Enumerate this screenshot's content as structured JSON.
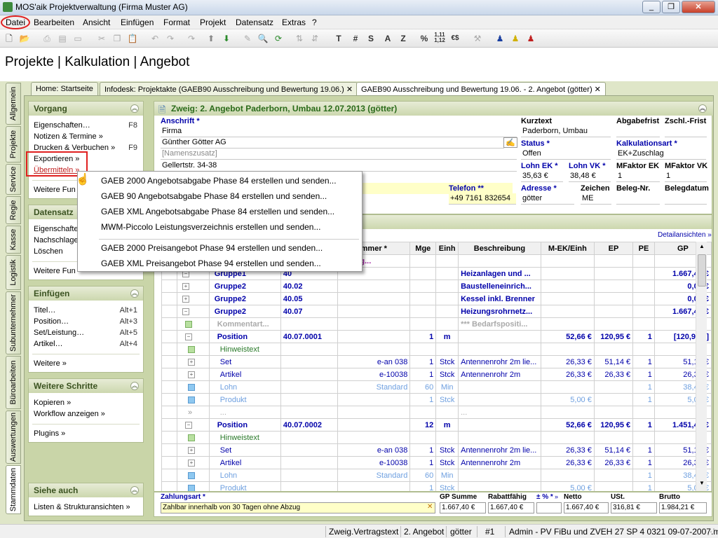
{
  "window": {
    "title": "MOS'aik Projektverwaltung (Firma Muster AG)",
    "controls": [
      "_",
      "❐",
      "✕"
    ]
  },
  "menu": [
    "Datei",
    "Bearbeiten",
    "Ansicht",
    "Einfügen",
    "Format",
    "Projekt",
    "Datensatz",
    "Extras",
    "?"
  ],
  "toolbar_text": {
    "t": "T",
    "hash": "#",
    "s": "S",
    "a": "A",
    "z": "Z",
    "pct": "%",
    "frac": "1,11\n1,12",
    "euro": "€$"
  },
  "page_title": "Projekte | Kalkulation | Angebot",
  "vtabs": [
    "Allgemein",
    "Projekte",
    "Service",
    "Regie",
    "Kasse",
    "Logistik",
    "Subunternehmer",
    "Büroarbeiten",
    "Auswertungen",
    "Stammdaten"
  ],
  "doctabs": [
    "Home: Startseite",
    "Infodesk: Projektakte (GAEB90 Ausschreibung und Bewertung 19.06.) ✕",
    "GAEB90 Ausschreibung und Bewertung 19.06. - 2. Angebot (götter) ✕"
  ],
  "panels": {
    "vorgang": {
      "title": "Vorgang",
      "items": [
        {
          "label": "Eigenschaften…",
          "key": "F8"
        },
        {
          "label": "Notizen & Termine »",
          "key": ""
        },
        {
          "label": "Drucken & Verbuchen »",
          "key": "F9"
        },
        {
          "label": "Exportieren »",
          "key": ""
        },
        {
          "label": "Übermitteln »",
          "key": ""
        },
        {
          "label": "Weitere Fun",
          "key": ""
        }
      ]
    },
    "datensatz": {
      "title": "Datensatz",
      "items": [
        "Eigenschafte",
        "Nachschlage",
        "Löschen",
        "Weitere Fun"
      ]
    },
    "einfuegen": {
      "title": "Einfügen",
      "items": [
        {
          "label": "Titel…",
          "key": "Alt+1"
        },
        {
          "label": "Position…",
          "key": "Alt+3"
        },
        {
          "label": "Set/Leistung…",
          "key": "Alt+5"
        },
        {
          "label": "Artikel…",
          "key": "Alt+4"
        },
        {
          "label": "Weitere »",
          "key": ""
        }
      ]
    },
    "weitere": {
      "title": "Weitere Schritte",
      "items": [
        "Kopieren »",
        "Workflow anzeigen »",
        "Plugins »"
      ]
    },
    "siehe": {
      "title": "Siehe auch",
      "items": [
        "Listen & Strukturansichten »"
      ]
    }
  },
  "popup": [
    "GAEB 2000 Angebotsabgabe Phase 84 erstellen und senden...",
    "GAEB 90 Angebotsabgabe Phase 84 erstellen und senden...",
    "GAEB XML Angebotsabgabe Phase 84 erstellen und senden...",
    "MWM-Piccolo Leistungsverzeichnis erstellen und senden...",
    "GAEB 2000 Preisangebot Phase 94 erstellen und senden...",
    "GAEB XML Preisangebot Phase 94 erstellen und senden..."
  ],
  "form": {
    "header": "Zweig: 2. Angebot Paderborn, Umbau 12.07.2013 (götter)",
    "anschrift_label": "Anschrift *",
    "anschrift": [
      "Firma",
      "Günther Götter AG",
      "[Namenszusatz]",
      "Gellertstr. 34-38"
    ],
    "kurztext_label": "Kurztext",
    "kurztext": "Paderborn, Umbau",
    "abgabefrist_label": "Abgabefrist",
    "zschl_label": "Zschl.-Frist",
    "status_label": "Status *",
    "status": "Offen",
    "kalkart_label": "Kalkulationsart *",
    "kalkart": "EK+Zuschlag",
    "lohnek_label": "Lohn EK *",
    "lohnek": "35,63 €",
    "lohnvk_label": "Lohn VK *",
    "lohnvk": "38,48 €",
    "mfek_label": "MFaktor EK",
    "mfek": "1",
    "mfvk_label": "MFaktor VK",
    "mfvk": "1",
    "telefon_label": "Telefon **",
    "telefon": "+49 7161 832654",
    "adresse_label": "Adresse *",
    "adresse": "götter",
    "zeichen_label": "Zeichen",
    "zeichen": "ME",
    "belegnr_label": "Beleg-Nr.",
    "belegdatum_label": "Belegdatum"
  },
  "grid": {
    "link": "Detailansichten »",
    "headers": [
      "",
      "",
      "",
      "mmer *",
      "Mge",
      "Einh",
      "Beschreibung",
      "M-EK/Einh",
      "EP",
      "PE",
      "GP"
    ],
    "rows": [
      {
        "tree": "",
        "type": "",
        "nr": "",
        "code": "B.Verg...",
        "mge": "",
        "einh": "",
        "besch": "",
        "mek": "",
        "ep": "",
        "pe": "",
        "gp": "",
        "style": "purple"
      },
      {
        "tree": "−",
        "type": "Gruppe1",
        "nr": "40",
        "code": "",
        "mge": "",
        "einh": "",
        "besch": "Heizanlagen und ...",
        "mek": "",
        "ep": "",
        "pe": "",
        "gp": "1.667,40 €",
        "style": "grp"
      },
      {
        "tree": "+",
        "type": "Gruppe2",
        "nr": "40.02",
        "code": "",
        "mge": "",
        "einh": "",
        "besch": "Baustelleneinrich...",
        "mek": "",
        "ep": "",
        "pe": "",
        "gp": "0,00 €",
        "style": "grp"
      },
      {
        "tree": "+",
        "type": "Gruppe2",
        "nr": "40.05",
        "code": "",
        "mge": "",
        "einh": "",
        "besch": "Kessel inkl. Brenner",
        "mek": "",
        "ep": "",
        "pe": "",
        "gp": "0,00 €",
        "style": "grp"
      },
      {
        "tree": "−",
        "type": "Gruppe2",
        "nr": "40.07",
        "code": "",
        "mge": "",
        "einh": "",
        "besch": "Heizungsrohrnetz...",
        "mek": "",
        "ep": "",
        "pe": "",
        "gp": "1.667,40 €",
        "style": "grp"
      },
      {
        "tree": "sq",
        "type": "Kommentart...",
        "nr": "",
        "code": "",
        "mge": "",
        "einh": "",
        "besch": "*** Bedarfspositi...",
        "mek": "",
        "ep": "",
        "pe": "",
        "gp": "",
        "style": "comment"
      },
      {
        "tree": "−",
        "type": "Position",
        "nr": "40.07.0001",
        "code": "",
        "mge": "1",
        "einh": "m",
        "besch": "",
        "mek": "52,66 €",
        "ep": "120,95 €",
        "pe": "1",
        "gp": "[120,95 €]",
        "style": "pos"
      },
      {
        "tree": "sqg",
        "type": "Hinweistext",
        "nr": "",
        "code": "",
        "mge": "",
        "einh": "",
        "besch": "",
        "mek": "",
        "ep": "",
        "pe": "",
        "gp": "",
        "style": "hint"
      },
      {
        "tree": "+",
        "type": "Set",
        "nr": "",
        "code": "e-an 038",
        "mge": "1",
        "einh": "Stck",
        "besch": "Antennenrohr 2m lie...",
        "mek": "26,33 €",
        "ep": "51,14 €",
        "pe": "1",
        "gp": "51,14 €",
        "style": "item"
      },
      {
        "tree": "+",
        "type": "Artikel",
        "nr": "",
        "code": "e-10038",
        "mge": "1",
        "einh": "Stck",
        "besch": "Antennenrohr 2m",
        "mek": "26,33 €",
        "ep": "26,33 €",
        "pe": "1",
        "gp": "26,33 €",
        "style": "item"
      },
      {
        "tree": "sqb",
        "type": "Lohn",
        "nr": "",
        "code": "Standard",
        "mge": "60",
        "einh": "Min",
        "besch": "",
        "mek": "",
        "ep": "",
        "pe": "1",
        "gp": "38,48 €",
        "style": "light"
      },
      {
        "tree": "sqb",
        "type": "Produkt",
        "nr": "",
        "code": "",
        "mge": "1",
        "einh": "Stck",
        "besch": "",
        "mek": "5,00 €",
        "ep": "",
        "pe": "1",
        "gp": "5,00 €",
        "style": "light"
      },
      {
        "tree": "»",
        "type": "...",
        "nr": "",
        "code": "",
        "mge": "",
        "einh": "",
        "besch": "...",
        "mek": "",
        "ep": "",
        "pe": "",
        "gp": "",
        "style": "dots"
      },
      {
        "tree": "−",
        "type": "Position",
        "nr": "40.07.0002",
        "code": "",
        "mge": "12",
        "einh": "m",
        "besch": "",
        "mek": "52,66 €",
        "ep": "120,95 €",
        "pe": "1",
        "gp": "1.451,40 €",
        "style": "pos"
      },
      {
        "tree": "sqg",
        "type": "Hinweistext",
        "nr": "",
        "code": "",
        "mge": "",
        "einh": "",
        "besch": "",
        "mek": "",
        "ep": "",
        "pe": "",
        "gp": "",
        "style": "hint"
      },
      {
        "tree": "+",
        "type": "Set",
        "nr": "",
        "code": "e-an 038",
        "mge": "1",
        "einh": "Stck",
        "besch": "Antennenrohr 2m lie...",
        "mek": "26,33 €",
        "ep": "51,14 €",
        "pe": "1",
        "gp": "51,14 €",
        "style": "item"
      },
      {
        "tree": "+",
        "type": "Artikel",
        "nr": "",
        "code": "e-10038",
        "mge": "1",
        "einh": "Stck",
        "besch": "Antennenrohr 2m",
        "mek": "26,33 €",
        "ep": "26,33 €",
        "pe": "1",
        "gp": "26,33 €",
        "style": "item"
      },
      {
        "tree": "sqb",
        "type": "Lohn",
        "nr": "",
        "code": "Standard",
        "mge": "60",
        "einh": "Min",
        "besch": "",
        "mek": "",
        "ep": "",
        "pe": "1",
        "gp": "38,48 €",
        "style": "light"
      },
      {
        "tree": "sqb",
        "type": "Produkt",
        "nr": "",
        "code": "",
        "mge": "1",
        "einh": "Stck",
        "besch": "",
        "mek": "5,00 €",
        "ep": "",
        "pe": "1",
        "gp": "5,00 €",
        "style": "light"
      }
    ]
  },
  "footer": {
    "zahlungsart_label": "Zahlungsart *",
    "zahlungsart": "Zahlbar innerhalb von 30 Tagen ohne Abzug",
    "gpsumme_label": "GP Summe",
    "gpsumme": "1.667,40 €",
    "rabatt_label": "Rabattfähig",
    "rabatt": "1.667,40 €",
    "pct_label": "± % *",
    "pct": "",
    "netto_label": "Netto",
    "netto": "1.667,40 €",
    "ust_label": "USt.",
    "ust": "316,81 €",
    "brutto_label": "Brutto",
    "brutto": "1.984,21 €"
  },
  "status": [
    "Zweig.Vertragstext",
    "2. Angebot",
    "götter",
    "#1",
    "Admin - PV FiBu und ZVEH 27 SP 4 0321 09-07-2007.mdb"
  ],
  "colors": {
    "accent": "#0000aa",
    "panel_title": "#3a5220",
    "highlight": "#e02020",
    "purple": "#a020a0"
  }
}
